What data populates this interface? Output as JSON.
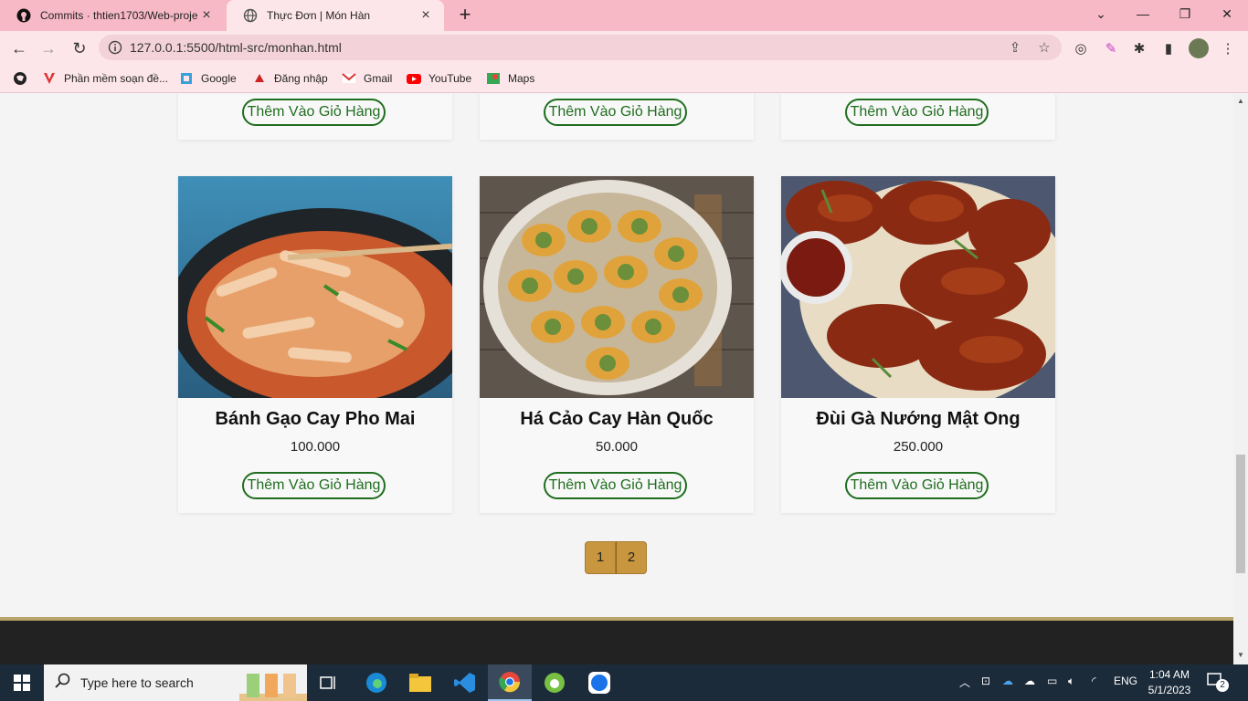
{
  "browser": {
    "tabs": [
      {
        "title": "Commits · thtien1703/Web-proje",
        "active": false
      },
      {
        "title": "Thực Đơn | Món Hàn",
        "active": true
      }
    ],
    "url": "127.0.0.1:5500/html-src/monhan.html",
    "bookmarks": [
      {
        "label": "Phần mềm soạn đề...",
        "icon": "v-logo-icon"
      },
      {
        "label": "Google",
        "icon": "google-icon"
      },
      {
        "label": "Đăng nhập",
        "icon": "login-icon"
      },
      {
        "label": "Gmail",
        "icon": "gmail-icon"
      },
      {
        "label": "YouTube",
        "icon": "youtube-icon"
      },
      {
        "label": "Maps",
        "icon": "maps-icon"
      }
    ]
  },
  "page": {
    "add_to_cart_label": "Thêm Vào Giỏ Hàng",
    "top_row": [
      {
        "button": "Thêm Vào Giỏ Hàng"
      },
      {
        "button": "Thêm Vào Giỏ Hàng"
      },
      {
        "button": "Thêm Vào Giỏ Hàng"
      }
    ],
    "products": [
      {
        "name": "Bánh Gạo Cay Pho Mai",
        "price": "100.000",
        "button": "Thêm Vào Giỏ Hàng",
        "image": "tteokbokki-photo"
      },
      {
        "name": "Há Cảo Cay Hàn Quốc",
        "price": "50.000",
        "button": "Thêm Vào Giỏ Hàng",
        "image": "dumplings-photo"
      },
      {
        "name": "Đùi Gà Nướng Mật Ong",
        "price": "250.000",
        "button": "Thêm Vào Giỏ Hàng",
        "image": "chicken-drumsticks-photo"
      }
    ],
    "pagination": [
      "1",
      "2"
    ]
  },
  "colors": {
    "button_green": "#1f6e1f",
    "pager_gold": "#c8963e",
    "tab_pink": "#f7b9c5",
    "footer_dark": "#222222"
  },
  "taskbar": {
    "search_placeholder": "Type here to search",
    "language": "ENG",
    "time": "1:04 AM",
    "date": "5/1/2023",
    "notification_count": "2"
  }
}
